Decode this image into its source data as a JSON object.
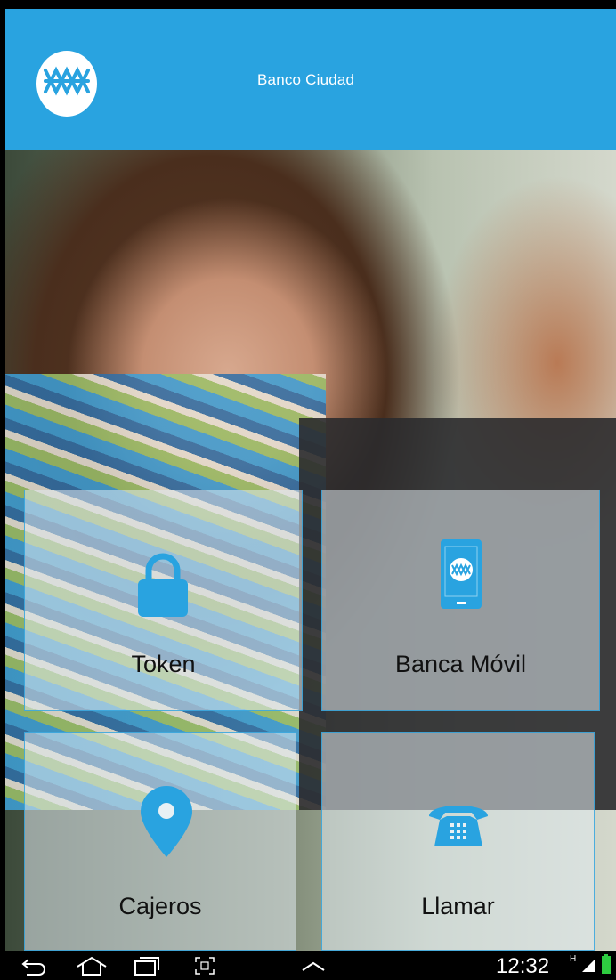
{
  "header": {
    "title": "Banco Ciudad",
    "logo_icon": "banco-ciudad-logo-icon"
  },
  "tiles": [
    {
      "label": "Token",
      "icon": "lock-icon"
    },
    {
      "label": "Banca Móvil",
      "icon": "mobile-phone-icon"
    },
    {
      "label": "Cajeros",
      "icon": "location-pin-icon"
    },
    {
      "label": "Llamar",
      "icon": "telephone-icon"
    }
  ],
  "status_bar": {
    "time": "12:32",
    "network": "H"
  },
  "colors": {
    "brand": "#29a3e0",
    "tile_bg": "rgba(225,235,240,0.55)"
  }
}
